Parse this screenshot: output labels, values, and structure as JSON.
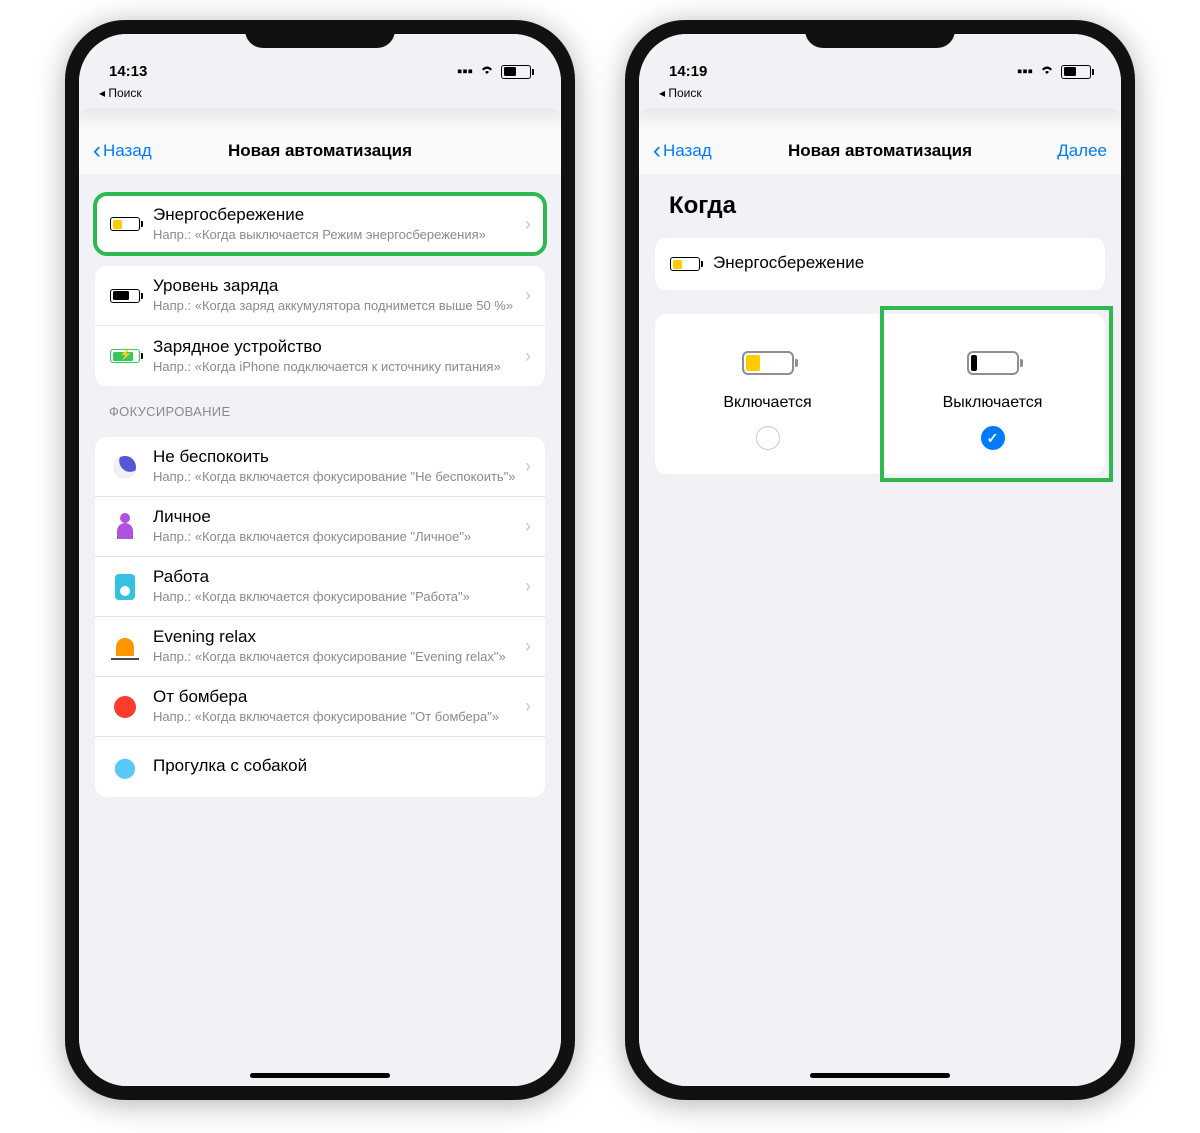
{
  "left": {
    "time": "14:13",
    "breadcrumb": "◂ Поиск",
    "nav_back": "Назад",
    "nav_title": "Новая автоматизация",
    "rows1": [
      {
        "title": "Энергосбережение",
        "subtitle": "Напр.: «Когда выключается Режим энергосбережения»"
      },
      {
        "title": "Уровень заряда",
        "subtitle": "Напр.: «Когда заряд аккумулятора поднимется выше 50 %»"
      },
      {
        "title": "Зарядное устройство",
        "subtitle": "Напр.: «Когда iPhone подключается к источнику питания»"
      }
    ],
    "section2_header": "ФОКУСИРОВАНИЕ",
    "rows2": [
      {
        "title": "Не беспокоить",
        "subtitle": "Напр.: «Когда включается фокусирование \"Не беспокоить\"»"
      },
      {
        "title": "Личное",
        "subtitle": "Напр.: «Когда включается фокусирование \"Личное\"»"
      },
      {
        "title": "Работа",
        "subtitle": "Напр.: «Когда включается фокусирование \"Работа\"»"
      },
      {
        "title": "Evening relax",
        "subtitle": "Напр.: «Когда включается фокусирование \"Evening relax\"»"
      },
      {
        "title": "От бомбера",
        "subtitle": "Напр.: «Когда включается фокусирование \"От бомбера\"»"
      },
      {
        "title": "Прогулка с собакой",
        "subtitle": ""
      }
    ]
  },
  "right": {
    "time": "14:19",
    "breadcrumb": "◂ Поиск",
    "nav_back": "Назад",
    "nav_title": "Новая автоматизация",
    "nav_next": "Далее",
    "heading": "Когда",
    "row_title": "Энергосбережение",
    "choice1": "Включается",
    "choice2": "Выключается"
  }
}
